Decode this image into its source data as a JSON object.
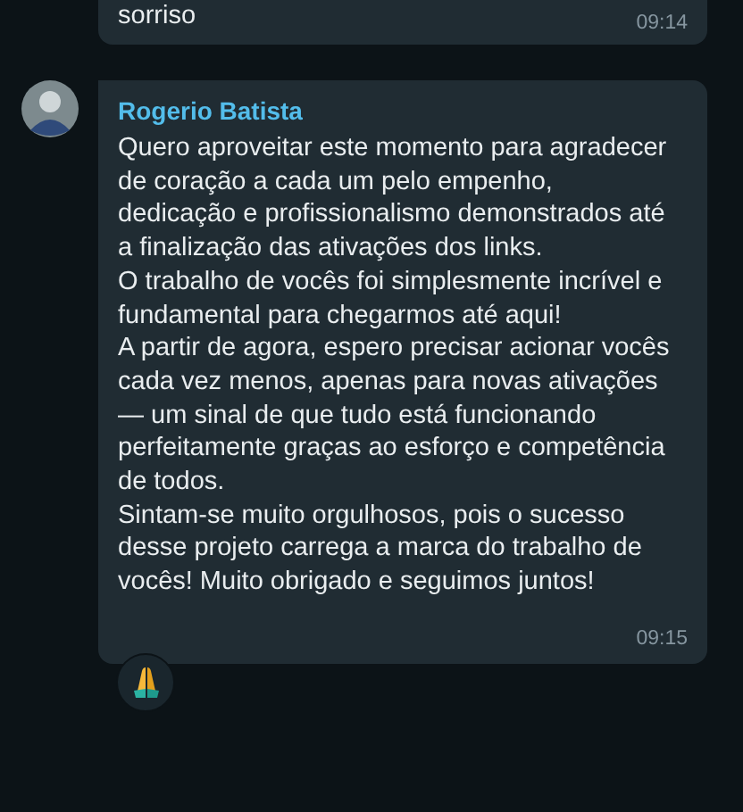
{
  "messages": [
    {
      "kind": "continued",
      "paragraphs": [
        "sorriso"
      ],
      "time": "09:14"
    },
    {
      "kind": "with_sender",
      "sender": "Rogerio Batista",
      "paragraphs": [
        "Quero aproveitar este momento para agradecer de coração a cada um pelo empenho, dedicação e profissionalismo demonstrados até a finalização das ativações dos links.",
        "O trabalho de vocês foi simplesmente incrível e fundamental para chegarmos até aqui!",
        "A partir de agora, espero precisar acionar vocês cada vez menos, apenas para novas ativações — um sinal de que tudo está funcionando perfeitamente graças ao esforço e competência de todos.",
        "Sintam-se muito orgulhosos, pois o sucesso desse projeto carrega a marca do trabalho de vocês! Muito obrigado e seguimos juntos!"
      ],
      "time": "09:15",
      "reaction": true
    }
  ]
}
